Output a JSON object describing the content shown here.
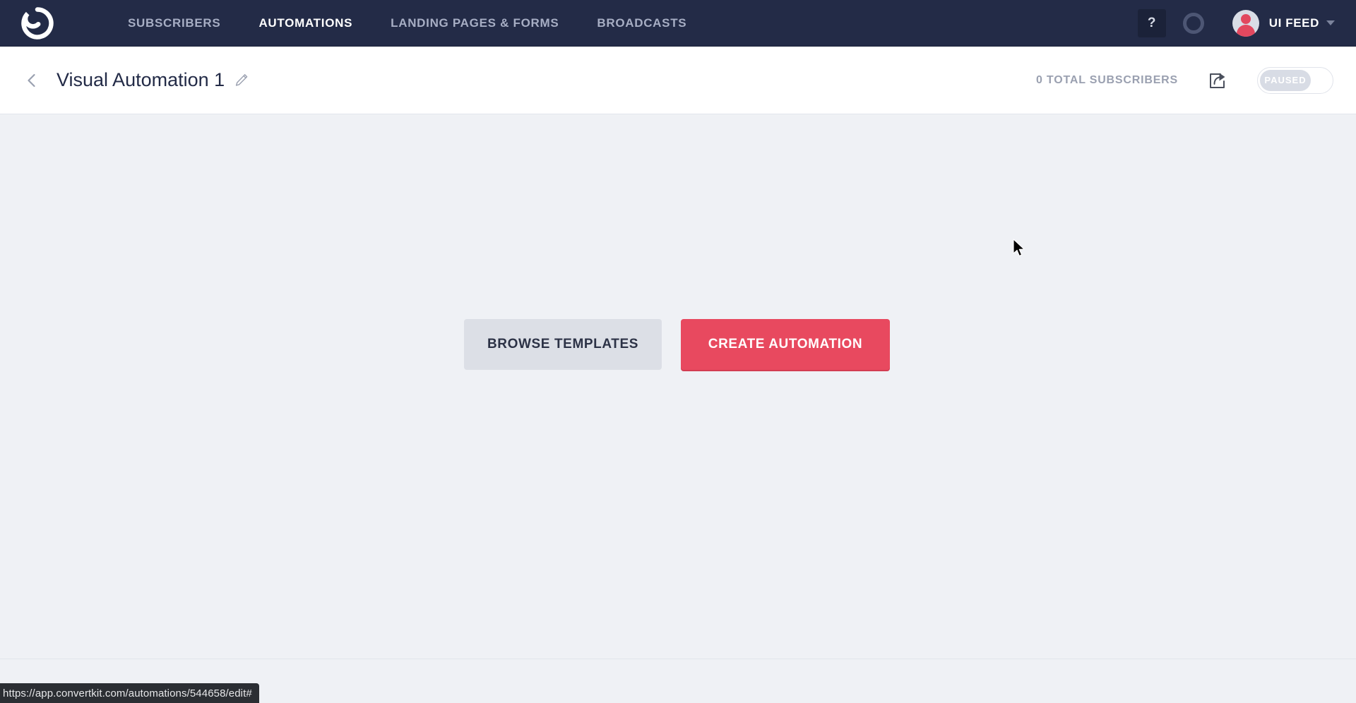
{
  "navbar": {
    "logo": "convertkit-logo",
    "links": [
      {
        "label": "SUBSCRIBERS",
        "active": false
      },
      {
        "label": "AUTOMATIONS",
        "active": true
      },
      {
        "label": "LANDING PAGES & FORMS",
        "active": false
      },
      {
        "label": "BROADCASTS",
        "active": false
      }
    ],
    "help_label": "?",
    "status_ring_icon": "circle-ring-icon",
    "account_name": "UI FEED",
    "background_color": "#232b47"
  },
  "subheader": {
    "back_icon": "chevron-left-icon",
    "title": "Visual Automation 1",
    "edit_icon": "pencil-icon",
    "subscriber_count": "0 TOTAL SUBSCRIBERS",
    "share_icon": "share-icon",
    "toggle_state": "PAUSED"
  },
  "main": {
    "browse_templates_label": "BROWSE TEMPLATES",
    "create_automation_label": "CREATE AUTOMATION",
    "accent_color": "#e8495f",
    "secondary_button_color": "#dcdfe6",
    "background_color": "#eff1f5"
  },
  "statusbar": {
    "url": "https://app.convertkit.com/automations/544658/edit#"
  }
}
